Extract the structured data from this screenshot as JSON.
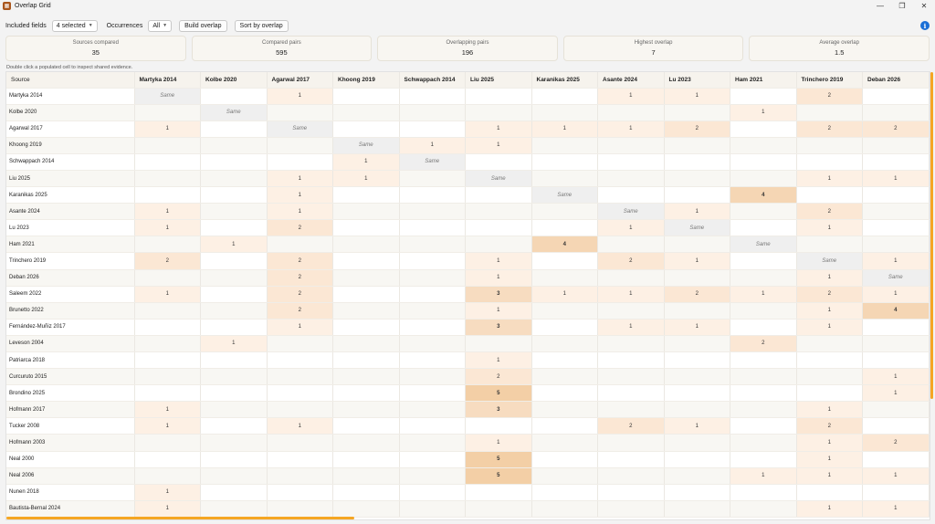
{
  "window": {
    "title": "Overlap Grid",
    "minimize": "—",
    "maximize": "❐",
    "close": "✕"
  },
  "toolbar": {
    "included_label": "Included fields",
    "included_value": "4 selected",
    "occurrences_label": "Occurrences",
    "occurrences_value": "All",
    "build_button": "Build overlap",
    "sort_button": "Sort by overlap",
    "info_icon": "i"
  },
  "stats": [
    {
      "title": "Sources compared",
      "value": "35"
    },
    {
      "title": "Compared pairs",
      "value": "595"
    },
    {
      "title": "Overlapping pairs",
      "value": "196"
    },
    {
      "title": "Highest overlap",
      "value": "7"
    },
    {
      "title": "Average overlap",
      "value": "1.5"
    }
  ],
  "hint": "Double click a populated cell to inspect shared evidence.",
  "colors": {
    "same": "#efefef",
    "l1": "#fdf0e4",
    "l2": "#fbe7d4",
    "l3": "#f7dcc0",
    "l4": "#f5d6b4",
    "l5": "#f3cfa6",
    "zebra": "#f8f7f3",
    "accent": "#f5a623"
  },
  "grid": {
    "source_header": "Source",
    "same_label": "Same",
    "columns": [
      "Martyka 2014",
      "Kolbe 2020",
      "Agarwal 2017",
      "Khoong 2019",
      "Schwappach 2014",
      "Liu 2025",
      "Karanikas 2025",
      "Asante 2024",
      "Lu 2023",
      "Ham 2021",
      "Trinchero 2019",
      "Deban 2026"
    ],
    "rows": [
      {
        "name": "Martyka 2014",
        "cells": [
          "S",
          "",
          "1",
          "",
          "",
          "",
          "",
          "1",
          "1",
          "",
          "2",
          ""
        ]
      },
      {
        "name": "Kolbe 2020",
        "cells": [
          "",
          "S",
          "",
          "",
          "",
          "",
          "",
          "",
          "",
          "1",
          "",
          ""
        ]
      },
      {
        "name": "Agarwal 2017",
        "cells": [
          "1",
          "",
          "S",
          "",
          "",
          "1",
          "1",
          "1",
          "2",
          "",
          "2",
          "2"
        ]
      },
      {
        "name": "Khoong 2019",
        "cells": [
          "",
          "",
          "",
          "S",
          "1",
          "1",
          "",
          "",
          "",
          "",
          "",
          ""
        ]
      },
      {
        "name": "Schwappach 2014",
        "cells": [
          "",
          "",
          "",
          "1",
          "S",
          "",
          "",
          "",
          "",
          "",
          "",
          ""
        ]
      },
      {
        "name": "Liu 2025",
        "cells": [
          "",
          "",
          "1",
          "1",
          "",
          "S",
          "",
          "",
          "",
          "",
          "1",
          "1"
        ]
      },
      {
        "name": "Karanikas 2025",
        "cells": [
          "",
          "",
          "1",
          "",
          "",
          "",
          "S",
          "",
          "",
          "4",
          "",
          ""
        ]
      },
      {
        "name": "Asante 2024",
        "cells": [
          "1",
          "",
          "1",
          "",
          "",
          "",
          "",
          "S",
          "1",
          "",
          "2",
          ""
        ]
      },
      {
        "name": "Lu 2023",
        "cells": [
          "1",
          "",
          "2",
          "",
          "",
          "",
          "",
          "1",
          "S",
          "",
          "1",
          ""
        ]
      },
      {
        "name": "Ham 2021",
        "cells": [
          "",
          "1",
          "",
          "",
          "",
          "",
          "4",
          "",
          "",
          "S",
          "",
          ""
        ]
      },
      {
        "name": "Trinchero 2019",
        "cells": [
          "2",
          "",
          "2",
          "",
          "",
          "1",
          "",
          "2",
          "1",
          "",
          "S",
          "1"
        ]
      },
      {
        "name": "Deban 2026",
        "cells": [
          "",
          "",
          "2",
          "",
          "",
          "1",
          "",
          "",
          "",
          "",
          "1",
          "S"
        ]
      },
      {
        "name": "Saleem 2022",
        "cells": [
          "1",
          "",
          "2",
          "",
          "",
          "3",
          "1",
          "1",
          "2",
          "1",
          "2",
          "1"
        ]
      },
      {
        "name": "Brunetto 2022",
        "cells": [
          "",
          "",
          "2",
          "",
          "",
          "1",
          "",
          "",
          "",
          "",
          "1",
          "4"
        ]
      },
      {
        "name": "Fernández-Muñiz 2017",
        "cells": [
          "",
          "",
          "1",
          "",
          "",
          "3",
          "",
          "1",
          "1",
          "",
          "1",
          ""
        ]
      },
      {
        "name": "Leveson 2004",
        "cells": [
          "",
          "1",
          "",
          "",
          "",
          "",
          "",
          "",
          "",
          "2",
          "",
          ""
        ]
      },
      {
        "name": "Patriarca 2018",
        "cells": [
          "",
          "",
          "",
          "",
          "",
          "1",
          "",
          "",
          "",
          "",
          "",
          ""
        ]
      },
      {
        "name": "Curcuruto 2015",
        "cells": [
          "",
          "",
          "",
          "",
          "",
          "2",
          "",
          "",
          "",
          "",
          "",
          "1"
        ]
      },
      {
        "name": "Brondino 2025",
        "cells": [
          "",
          "",
          "",
          "",
          "",
          "5",
          "",
          "",
          "",
          "",
          "",
          "1"
        ]
      },
      {
        "name": "Hofmann 2017",
        "cells": [
          "1",
          "",
          "",
          "",
          "",
          "3",
          "",
          "",
          "",
          "",
          "1",
          ""
        ]
      },
      {
        "name": "Tucker 2008",
        "cells": [
          "1",
          "",
          "1",
          "",
          "",
          "",
          "",
          "2",
          "1",
          "",
          "2",
          ""
        ]
      },
      {
        "name": "Hofmann 2003",
        "cells": [
          "",
          "",
          "",
          "",
          "",
          "1",
          "",
          "",
          "",
          "",
          "1",
          "2"
        ]
      },
      {
        "name": "Neal 2000",
        "cells": [
          "",
          "",
          "",
          "",
          "",
          "5",
          "",
          "",
          "",
          "",
          "1",
          ""
        ]
      },
      {
        "name": "Neal 2006",
        "cells": [
          "",
          "",
          "",
          "",
          "",
          "5",
          "",
          "",
          "",
          "1",
          "1",
          "1"
        ]
      },
      {
        "name": "Nunen 2018",
        "cells": [
          "1",
          "",
          "",
          "",
          "",
          "",
          "",
          "",
          "",
          "",
          "",
          ""
        ]
      },
      {
        "name": "Bautista-Bernal 2024",
        "cells": [
          "1",
          "",
          "",
          "",
          "",
          "",
          "",
          "",
          "",
          "",
          "1",
          "1"
        ]
      }
    ]
  }
}
